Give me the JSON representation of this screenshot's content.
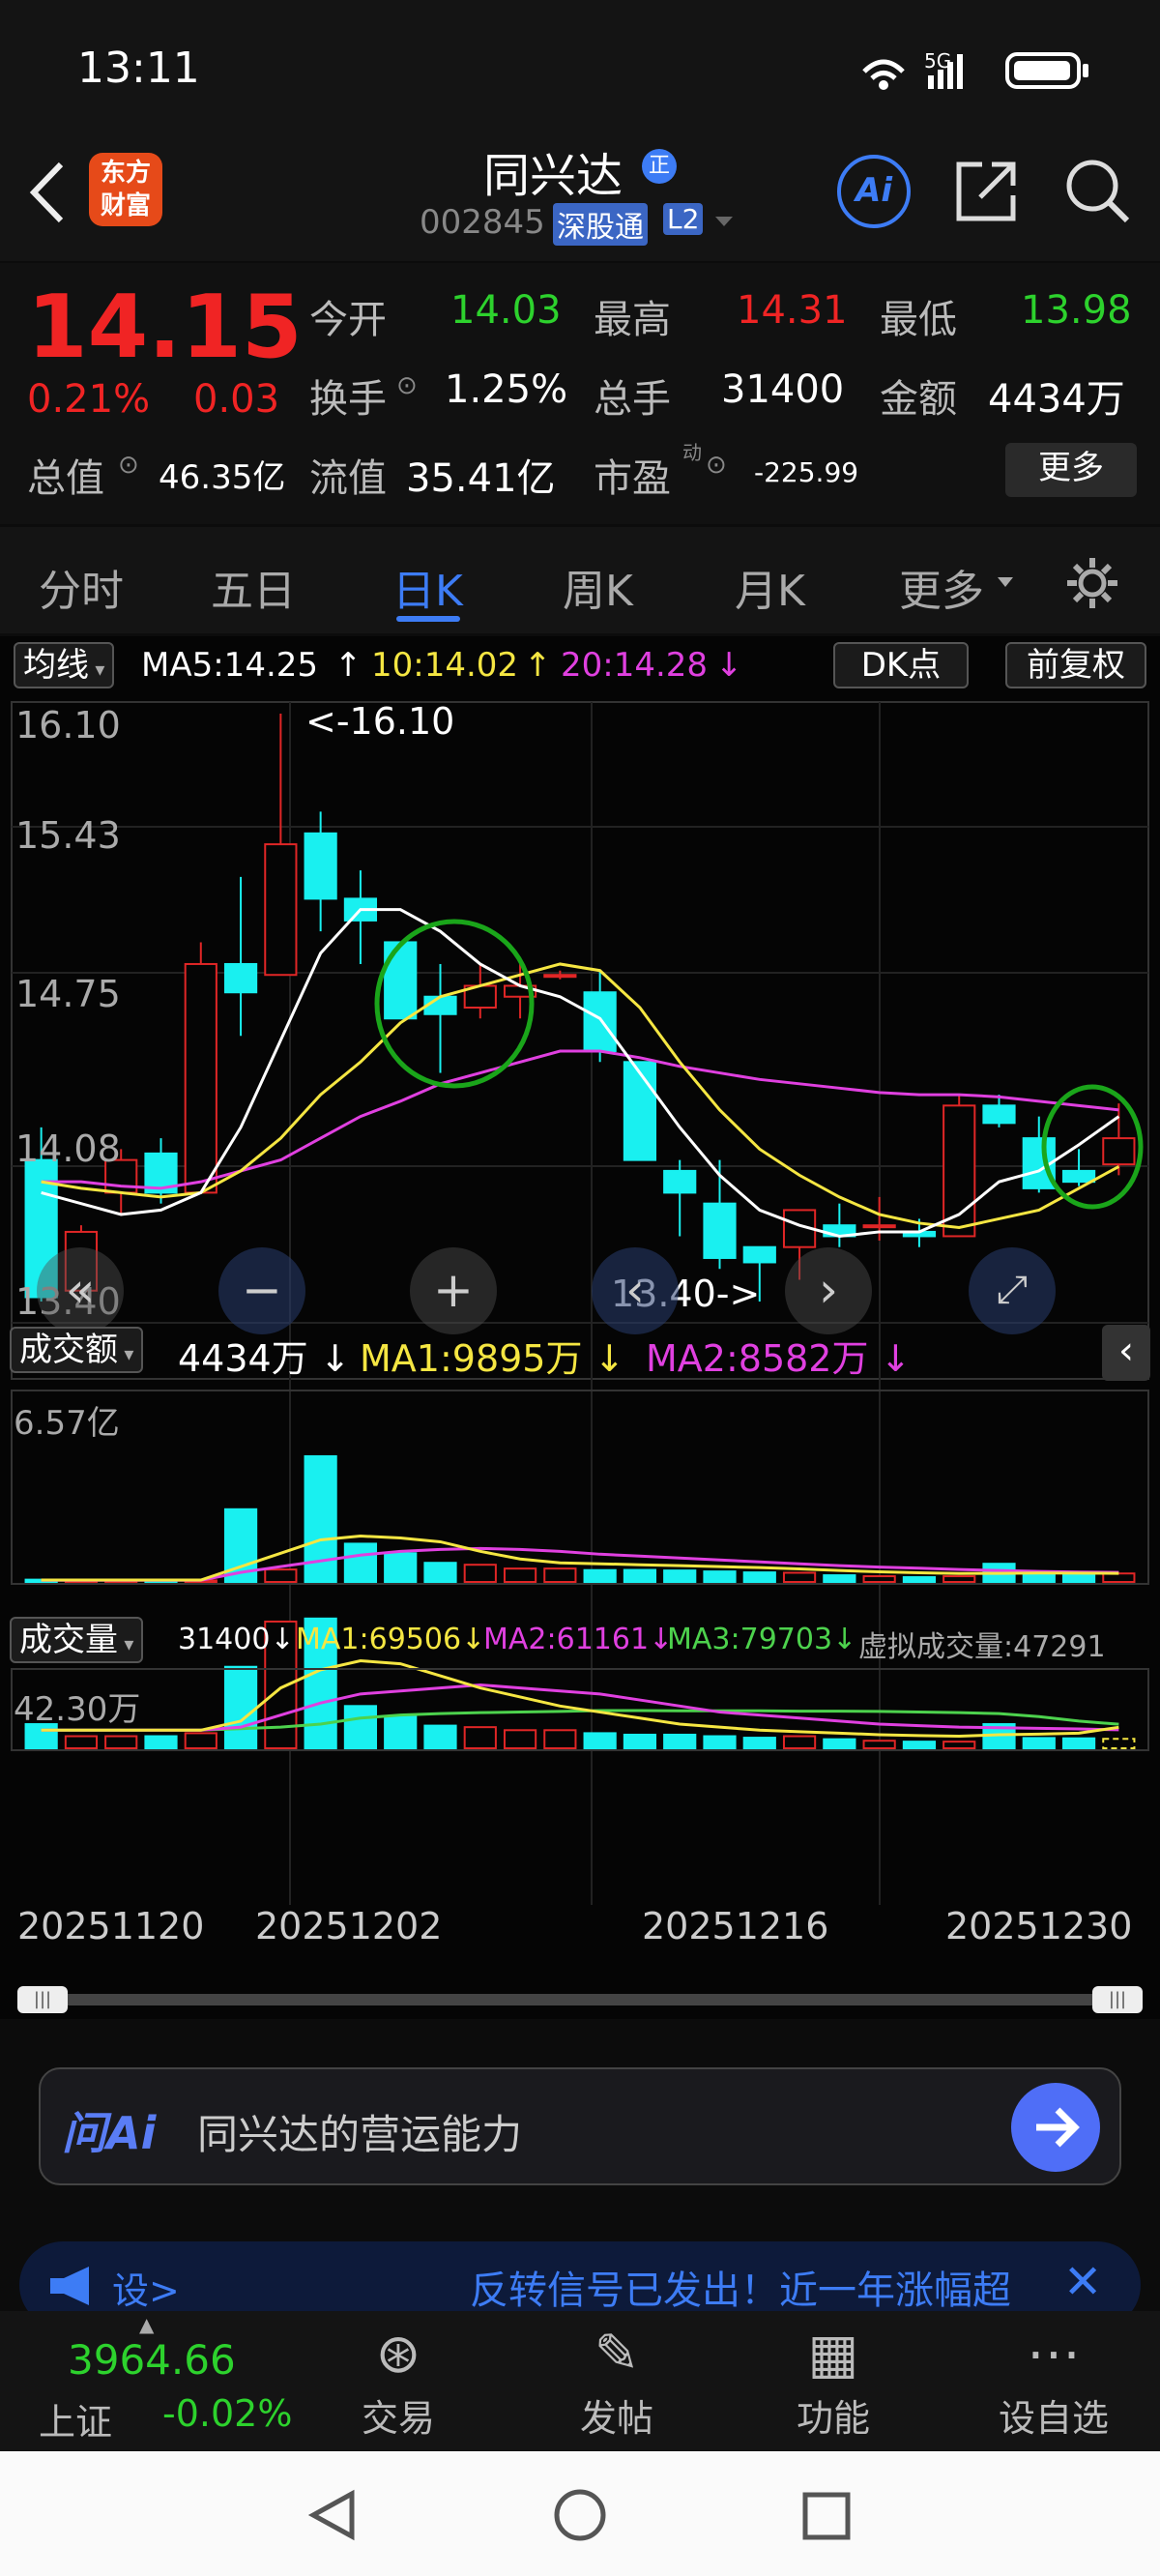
{
  "status_bar": {
    "time": "13:11",
    "network": "5G"
  },
  "header": {
    "back_icon": "chevron-left-icon",
    "app_badge": "东方财富",
    "stock_name": "同兴达",
    "name_badge": "正",
    "stock_code": "002845",
    "market_tag": "深股通",
    "level_tag": "L2",
    "ai_label": "Ai",
    "share_icon": "share-icon",
    "search_icon": "search-icon"
  },
  "quote": {
    "price": "14.15",
    "change_pct": "0.21%",
    "change": "0.03",
    "open_label": "今开",
    "open": "14.03",
    "high_label": "最高",
    "high": "14.31",
    "low_label": "最低",
    "low": "13.98",
    "turnover_label": "换手",
    "turnover": "1.25%",
    "volume_label": "总手",
    "volume": "31400",
    "amount_label": "金额",
    "amount": "4434万",
    "mcap_label": "总值",
    "mcap": "46.35亿",
    "float_label": "流值",
    "float_value": "35.41亿",
    "pe_label": "市盈",
    "pe_sup": "动",
    "pe": "-225.99",
    "more_button": "更多"
  },
  "tabs": [
    "分时",
    "五日",
    "日K",
    "周K",
    "月K",
    "更多"
  ],
  "active_tab": "日K",
  "kline": {
    "ma_selector": "均线",
    "ma5": "MA5:14.25",
    "ma10": "10:14.02",
    "ma20": "20:14.28",
    "dk_button": "DK点",
    "adjust_button": "前复权",
    "y_labels": [
      "16.10",
      "15.43",
      "14.75",
      "14.08",
      "13.40"
    ],
    "max_marker": "<-16.10",
    "min_marker": "13.40->",
    "colors": {
      "up": "#e02626",
      "down": "#19f0f0",
      "ma5": "#ffffff",
      "ma10": "#f5e642",
      "ma20": "#e040e0",
      "ma_vol3": "#4dd24d"
    }
  },
  "amount_panel": {
    "selector": "成交额",
    "current": "4434万",
    "ma1": "MA1:9895万",
    "ma2": "MA2:8582万",
    "max_label": "6.57亿"
  },
  "volume_panel": {
    "selector": "成交量",
    "current": "31400",
    "ma1": "MA1:69506",
    "ma2": "MA2:61161",
    "ma3": "MA3:79703",
    "virtual": "虚拟成交量:47291",
    "max_label": "42.30万"
  },
  "dates": [
    "20251120",
    "20251202",
    "20251216",
    "20251230"
  ],
  "ask_ai": {
    "logo": "问Ai",
    "prompt": "同兴达的营运能力"
  },
  "ad_banner": {
    "prefix": "设>",
    "text": "反转信号已发出！近一年涨幅超"
  },
  "bottom_nav": {
    "index_value": "3964.66",
    "index_name": "上证",
    "index_change": "-0.02%",
    "items": [
      "交易",
      "发帖",
      "功能",
      "设自选"
    ]
  },
  "chart_data": {
    "type": "candlestick",
    "ylim": [
      13.4,
      16.1
    ],
    "candles": [
      {
        "o": 14.05,
        "h": 14.2,
        "l": 13.4,
        "c": 13.42
      },
      {
        "o": 13.45,
        "h": 13.75,
        "l": 13.45,
        "c": 13.72
      },
      {
        "o": 13.9,
        "h": 14.1,
        "l": 13.8,
        "c": 14.05
      },
      {
        "o": 14.08,
        "h": 14.15,
        "l": 13.85,
        "c": 13.9
      },
      {
        "o": 13.9,
        "h": 15.05,
        "l": 13.9,
        "c": 14.95
      },
      {
        "o": 14.95,
        "h": 15.35,
        "l": 14.62,
        "c": 14.82
      },
      {
        "o": 14.9,
        "h": 16.1,
        "l": 14.9,
        "c": 15.5
      },
      {
        "o": 15.55,
        "h": 15.65,
        "l": 15.1,
        "c": 15.25
      },
      {
        "o": 15.25,
        "h": 15.38,
        "l": 14.95,
        "c": 15.15
      },
      {
        "o": 15.05,
        "h": 15.05,
        "l": 14.7,
        "c": 14.7
      },
      {
        "o": 14.8,
        "h": 14.95,
        "l": 14.45,
        "c": 14.72
      },
      {
        "o": 14.75,
        "h": 14.95,
        "l": 14.7,
        "c": 14.85
      },
      {
        "o": 14.8,
        "h": 14.95,
        "l": 14.7,
        "c": 14.85
      },
      {
        "o": 14.9,
        "h": 14.92,
        "l": 14.88,
        "c": 14.9
      },
      {
        "o": 14.82,
        "h": 14.92,
        "l": 14.5,
        "c": 14.55
      },
      {
        "o": 14.5,
        "h": 14.5,
        "l": 14.05,
        "c": 14.05
      },
      {
        "o": 14.0,
        "h": 14.05,
        "l": 13.7,
        "c": 13.9
      },
      {
        "o": 13.85,
        "h": 14.05,
        "l": 13.55,
        "c": 13.6
      },
      {
        "o": 13.65,
        "h": 13.65,
        "l": 13.4,
        "c": 13.58
      },
      {
        "o": 13.65,
        "h": 13.8,
        "l": 13.5,
        "c": 13.82
      },
      {
        "o": 13.75,
        "h": 13.85,
        "l": 13.65,
        "c": 13.7
      },
      {
        "o": 13.75,
        "h": 13.88,
        "l": 13.68,
        "c": 13.75
      },
      {
        "o": 13.72,
        "h": 13.78,
        "l": 13.65,
        "c": 13.7
      },
      {
        "o": 13.7,
        "h": 14.35,
        "l": 13.7,
        "c": 14.3
      },
      {
        "o": 14.3,
        "h": 14.35,
        "l": 14.2,
        "c": 14.22
      },
      {
        "o": 14.15,
        "h": 14.25,
        "l": 13.9,
        "c": 13.92
      },
      {
        "o": 14.0,
        "h": 14.1,
        "l": 13.93,
        "c": 13.95
      },
      {
        "o": 14.03,
        "h": 14.31,
        "l": 13.98,
        "c": 14.15
      }
    ],
    "ma5": [
      13.9,
      13.85,
      13.8,
      13.82,
      13.9,
      14.2,
      14.6,
      15.0,
      15.2,
      15.2,
      15.1,
      14.95,
      14.85,
      14.8,
      14.7,
      14.45,
      14.2,
      13.98,
      13.82,
      13.75,
      13.7,
      13.72,
      13.72,
      13.8,
      13.95,
      14.0,
      14.12,
      14.25
    ],
    "ma10": [
      13.95,
      13.92,
      13.9,
      13.88,
      13.9,
      14.0,
      14.15,
      14.35,
      14.5,
      14.68,
      14.8,
      14.85,
      14.9,
      14.95,
      14.92,
      14.75,
      14.5,
      14.28,
      14.1,
      13.98,
      13.88,
      13.8,
      13.76,
      13.74,
      13.78,
      13.82,
      13.92,
      14.02
    ],
    "ma20": [
      13.95,
      13.95,
      13.93,
      13.92,
      13.95,
      14.0,
      14.05,
      14.15,
      14.25,
      14.32,
      14.4,
      14.45,
      14.5,
      14.55,
      14.55,
      14.52,
      14.48,
      14.45,
      14.42,
      14.4,
      14.38,
      14.36,
      14.35,
      14.35,
      14.34,
      14.32,
      14.3,
      14.28
    ],
    "amount_ylim": [
      0,
      65700
    ],
    "amount": [
      1200,
      600,
      600,
      600,
      800,
      38000,
      6500,
      65700,
      20000,
      15000,
      10000,
      9000,
      7000,
      7000,
      6200,
      6300,
      6000,
      5500,
      5000,
      4800,
      3500,
      3000,
      2500,
      3000,
      9500,
      4300,
      4200,
      4434
    ],
    "amount_ma1": [
      1000,
      1000,
      1000,
      1000,
      1000,
      8000,
      15000,
      22000,
      24000,
      23000,
      21000,
      16000,
      12000,
      10000,
      9500,
      9000,
      8500,
      8000,
      7500,
      6800,
      6000,
      5300,
      4800,
      4400,
      4500,
      4700,
      4600,
      4500
    ],
    "amount_ma2": [
      900,
      900,
      900,
      900,
      900,
      5000,
      8000,
      11000,
      14000,
      16000,
      17000,
      17500,
      17000,
      16000,
      14500,
      13500,
      12500,
      11500,
      10500,
      9500,
      8500,
      7800,
      7200,
      6500,
      6000,
      5500,
      5200,
      5000
    ],
    "volume_ylim": [
      0,
      423000
    ],
    "volume": [
      80000,
      40000,
      40000,
      40000,
      50000,
      270000,
      420000,
      430000,
      140000,
      105000,
      75000,
      70000,
      60000,
      60000,
      50000,
      45000,
      45000,
      40000,
      35000,
      40000,
      30000,
      25000,
      22000,
      22000,
      80000,
      34000,
      33000,
      31400
    ],
    "vol_ma1": [
      60000,
      60000,
      60000,
      60000,
      60000,
      90000,
      200000,
      260000,
      290000,
      280000,
      240000,
      200000,
      170000,
      140000,
      120000,
      100000,
      80000,
      70000,
      60000,
      55000,
      50000,
      45000,
      42000,
      40000,
      45000,
      47000,
      50000,
      69506
    ],
    "vol_ma2": [
      60000,
      60000,
      60000,
      60000,
      60000,
      70000,
      110000,
      150000,
      180000,
      190000,
      200000,
      210000,
      200000,
      190000,
      180000,
      160000,
      140000,
      120000,
      110000,
      100000,
      90000,
      80000,
      75000,
      70000,
      68000,
      66000,
      64000,
      61161
    ],
    "vol_ma3": [
      60000,
      60000,
      60000,
      60000,
      60000,
      65000,
      70000,
      80000,
      100000,
      110000,
      115000,
      118000,
      120000,
      122000,
      125000,
      125000,
      124000,
      124000,
      124000,
      123000,
      123000,
      122000,
      120000,
      118000,
      115000,
      105000,
      90000,
      79703
    ]
  }
}
